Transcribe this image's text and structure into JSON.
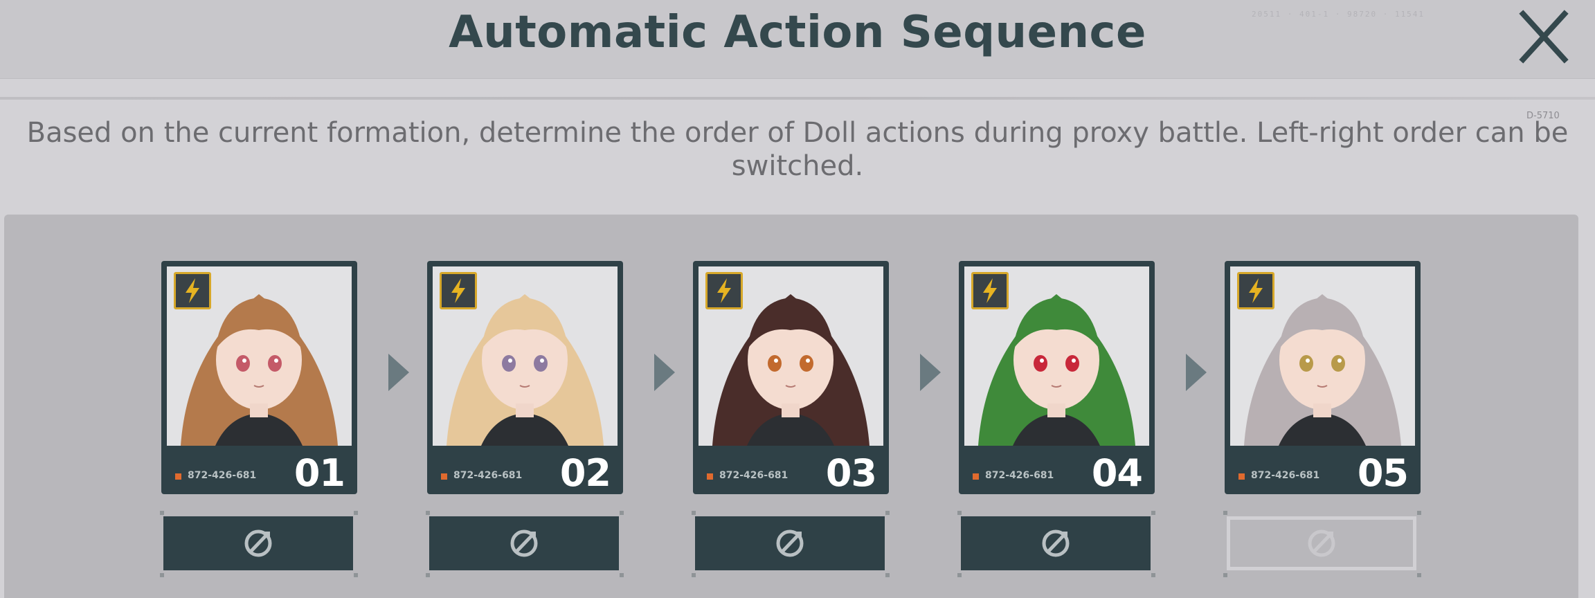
{
  "header": {
    "title": "Automatic Action Sequence",
    "code": "20511 · 401-1 · 98720 · 11541",
    "close_icon": "close-icon"
  },
  "side_code": "D-5710",
  "description": "Based on the current formation, determine the order of Doll actions during proxy battle. Left-right order can be switched.",
  "cards": [
    {
      "number": "01",
      "serial": "872-426-681",
      "badge_icon": "lightning-icon",
      "hair_color": "#b47a4c",
      "eye_color": "#c45a68"
    },
    {
      "number": "02",
      "serial": "872-426-681",
      "badge_icon": "lightning-icon",
      "hair_color": "#e6c79a",
      "eye_color": "#8d7aa0"
    },
    {
      "number": "03",
      "serial": "872-426-681",
      "badge_icon": "lightning-icon",
      "hair_color": "#4a2d2a",
      "eye_color": "#c26a2e"
    },
    {
      "number": "04",
      "serial": "872-426-681",
      "badge_icon": "lightning-icon",
      "hair_color": "#3f8a3a",
      "eye_color": "#c8283a"
    },
    {
      "number": "05",
      "serial": "872-426-681",
      "badge_icon": "lightning-icon",
      "hair_color": "#b8b0b3",
      "eye_color": "#b89a4a"
    }
  ],
  "buttons": [
    {
      "icon": "target-icon",
      "state": "enabled"
    },
    {
      "icon": "target-icon",
      "state": "enabled"
    },
    {
      "icon": "target-icon",
      "state": "enabled"
    },
    {
      "icon": "target-icon",
      "state": "enabled"
    },
    {
      "icon": "target-icon",
      "state": "disabled"
    }
  ],
  "colors": {
    "card_bg": "#2f4147",
    "badge_border": "#d7a82a",
    "serial_dot": "#e06a2e",
    "title_color": "#34484d"
  }
}
